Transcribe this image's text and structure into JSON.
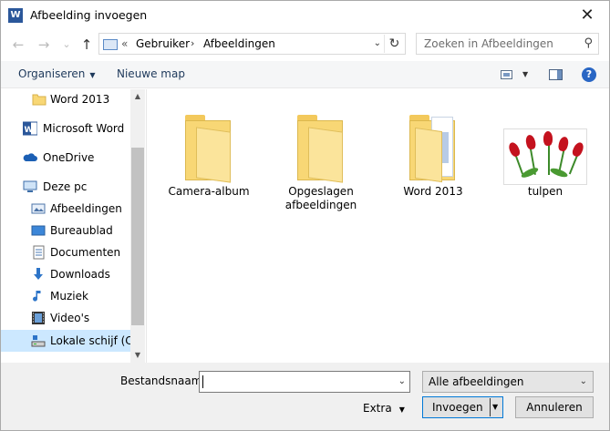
{
  "title": "Afbeelding invoegen",
  "app_icon": "W",
  "close_label": "✕",
  "nav": {
    "back": "←",
    "forward": "→",
    "recent": "⌄",
    "up": "↑"
  },
  "address": {
    "overflow": "«",
    "crumbs": [
      "Gebruiker",
      "Afbeeldingen"
    ],
    "sep": "›"
  },
  "search_placeholder": "Zoeken in Afbeeldingen",
  "toolbar": {
    "organize": "Organiseren",
    "new_folder": "Nieuwe map",
    "help": "?"
  },
  "sidebar": [
    {
      "label": "Word 2013",
      "icon": "folder-icon"
    },
    {
      "label": "Microsoft Word",
      "icon": "word-icon"
    },
    {
      "label": "OneDrive",
      "icon": "cloud-icon"
    },
    {
      "label": "Deze pc",
      "icon": "computer-icon"
    },
    {
      "label": "Afbeeldingen",
      "icon": "pictures-icon"
    },
    {
      "label": "Bureaublad",
      "icon": "desktop-icon"
    },
    {
      "label": "Documenten",
      "icon": "documents-icon"
    },
    {
      "label": "Downloads",
      "icon": "download-icon"
    },
    {
      "label": "Muziek",
      "icon": "music-icon"
    },
    {
      "label": "Video's",
      "icon": "video-icon"
    },
    {
      "label": "Lokale schijf (C:)",
      "icon": "drive-icon"
    }
  ],
  "files": [
    {
      "name": "Camera-album",
      "type": "folder"
    },
    {
      "name": "Opgeslagen afbeeldingen",
      "type": "folder"
    },
    {
      "name": "Word 2013",
      "type": "folder"
    },
    {
      "name": "tulpen",
      "type": "image"
    }
  ],
  "footer": {
    "filename_label": "Bestandsnaam:",
    "filename_value": "",
    "filter": "Alle afbeeldingen",
    "extra": "Extra",
    "insert": "Invoegen",
    "cancel": "Annuleren"
  }
}
